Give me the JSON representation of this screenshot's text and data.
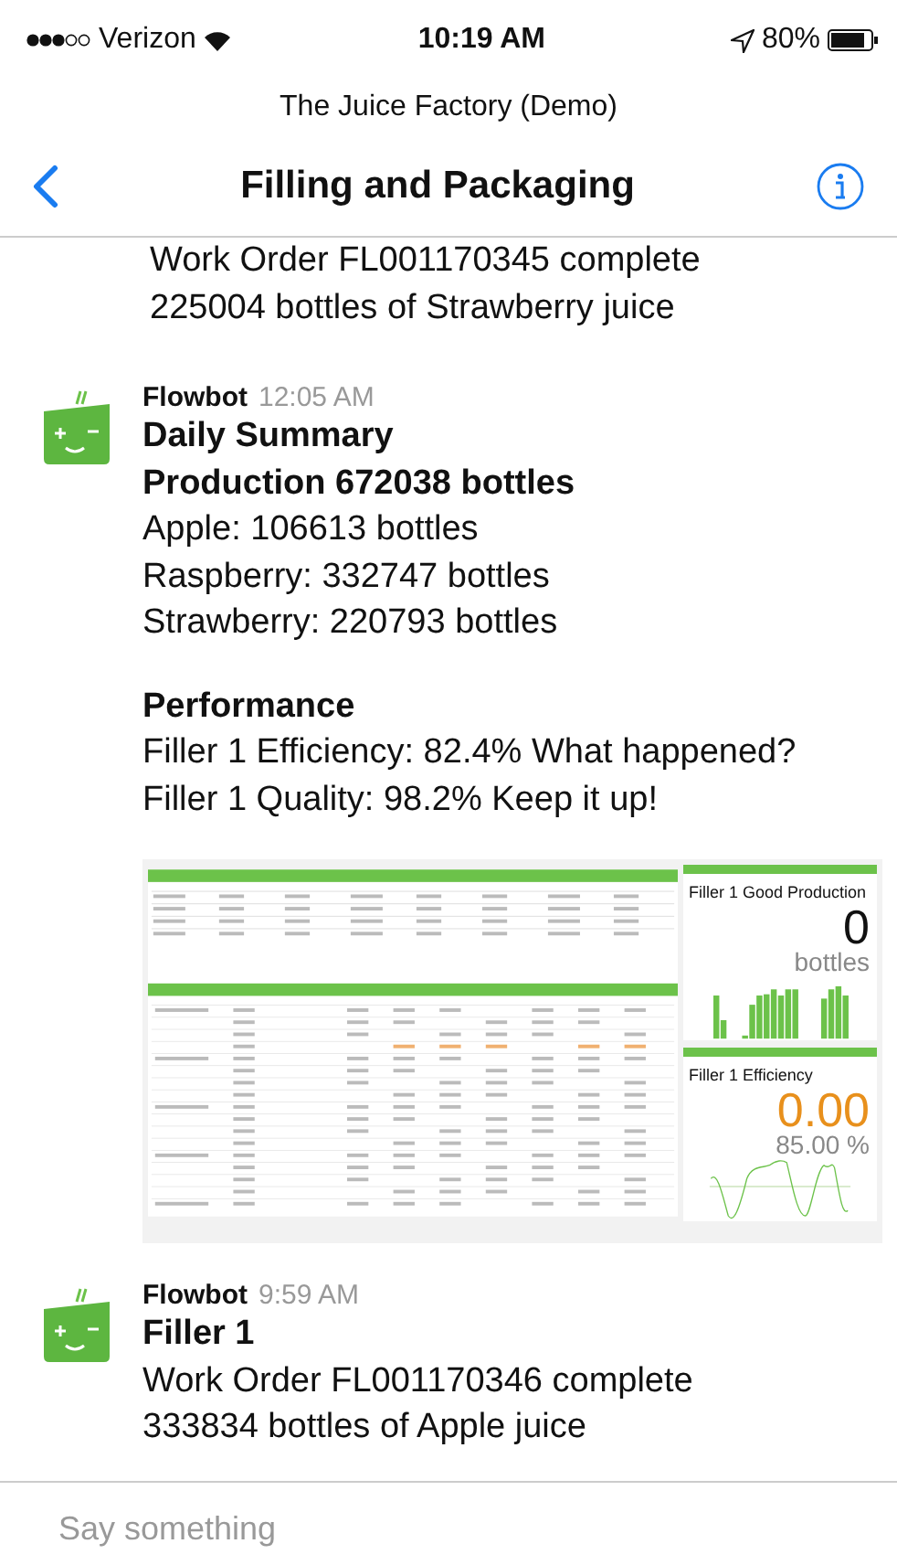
{
  "status_bar": {
    "carrier": "Verizon",
    "time": "10:19 AM",
    "battery": "80%"
  },
  "header": {
    "subtitle": "The Juice Factory (Demo)",
    "title": "Filling and Packaging"
  },
  "messages": [
    {
      "kind": "continuation",
      "paragraphs": [
        {
          "lines": [
            {
              "text": "Work Order FL001170345 complete",
              "bold": false
            },
            {
              "text": "225004 bottles of Strawberry juice",
              "bold": false
            }
          ]
        }
      ]
    },
    {
      "kind": "post",
      "author": "Flowbot",
      "time": "12:05 AM",
      "paragraphs": [
        {
          "lines": [
            {
              "text": "Daily Summary",
              "bold": true
            },
            {
              "text": "Production 672038 bottles",
              "bold": true
            },
            {
              "text": "Apple: 106613 bottles",
              "bold": false
            },
            {
              "text": "Raspberry: 332747 bottles",
              "bold": false
            },
            {
              "text": "Strawberry: 220793 bottles",
              "bold": false
            }
          ]
        },
        {
          "lines": [
            {
              "text": "Performance",
              "bold": true
            },
            {
              "text": "Filler 1 Efficiency: 82.4% What happened?",
              "bold": false
            },
            {
              "text": "Filler 1 Quality: 98.2% Keep it up!",
              "bold": false
            }
          ]
        }
      ],
      "attachment": {
        "kind": "dashboard",
        "tiles": [
          {
            "kind": "bars",
            "title": "Filler 1 Good Production",
            "value": "0",
            "unit": "bottles",
            "color": "#111111"
          },
          {
            "kind": "line",
            "title": "Filler 1 Efficiency",
            "value": "0.00",
            "unit": "85.00 %",
            "color": "#e8901c"
          }
        ]
      }
    },
    {
      "kind": "post",
      "author": "Flowbot",
      "time": "9:59 AM",
      "paragraphs": [
        {
          "lines": [
            {
              "text": "Filler 1",
              "bold": true
            },
            {
              "text": "Work Order FL001170346 complete",
              "bold": false
            },
            {
              "text": "333834 bottles of Apple juice",
              "bold": false
            }
          ]
        }
      ]
    }
  ],
  "composer": {
    "placeholder": "Say something"
  }
}
